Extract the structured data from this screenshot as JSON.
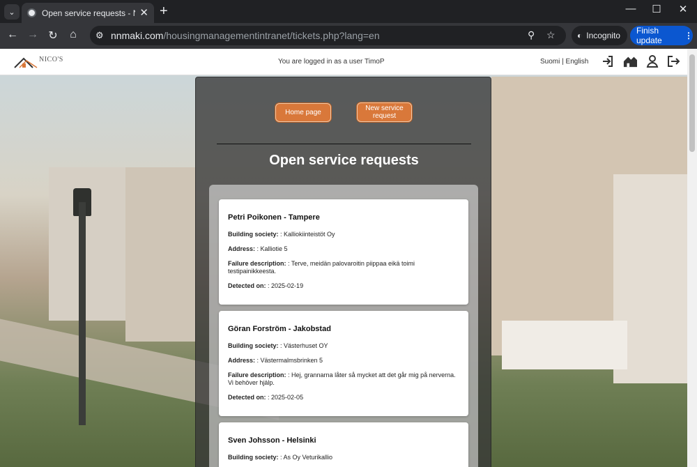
{
  "browser": {
    "tab_title": "Open service requests - Nico's H",
    "url_host": "nnmaki.com",
    "url_path": "/housingmanagementintranet/tickets.php?lang=en",
    "incognito_label": "Incognito",
    "finish_update_label": "Finish update"
  },
  "header": {
    "logo_text": "NICO'S",
    "logged_in_text": "You are logged in as a user TimoP",
    "lang_fi": "Suomi",
    "lang_sep": "|",
    "lang_en": "English"
  },
  "main": {
    "home_button": "Home page",
    "new_request_button": "New service request",
    "title": "Open service requests",
    "labels": {
      "building_society": "Building society:",
      "address": "Address:",
      "failure": "Failure description:",
      "detected": "Detected on:"
    },
    "tickets": [
      {
        "name": "Petri Poikonen - Tampere",
        "building_society": ": Kalliokiinteistöt Oy",
        "address": ": Kalliotie 5",
        "failure": ": Terve, meidän palovaroitin piippaa eikä toimi testipainikkeesta.",
        "detected": ": 2025-02-19"
      },
      {
        "name": "Göran Forström - Jakobstad",
        "building_society": ": Västerhuset OY",
        "address": ": Västermalmsbrinken 5",
        "failure": ": Hej, grannarna låter så mycket att det går mig på nerverna. Vi behöver hjälp.",
        "detected": ": 2025-02-05"
      },
      {
        "name": "Sven Johsson - Helsinki",
        "building_society": ": As Oy Veturikallio"
      }
    ]
  }
}
